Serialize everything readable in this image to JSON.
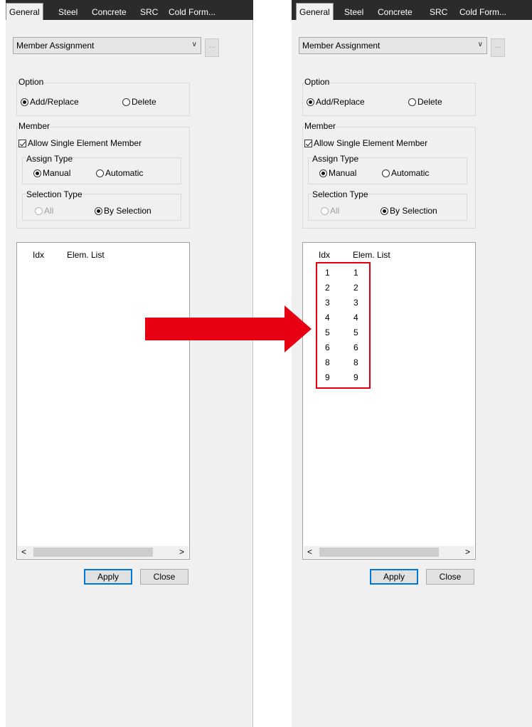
{
  "tabs": [
    "General",
    "Steel",
    "Concrete",
    "SRC",
    "Cold Form..."
  ],
  "combo": {
    "value": "Member Assignment"
  },
  "more_button": {
    "label": "..."
  },
  "option": {
    "title": "Option",
    "add_replace": "Add/Replace",
    "delete": "Delete",
    "selected": "Add/Replace"
  },
  "member": {
    "title": "Member",
    "allow_single": "Allow Single Element Member",
    "allow_single_checked": true,
    "assign_type": {
      "title": "Assign Type",
      "manual": "Manual",
      "automatic": "Automatic",
      "selected": "Manual"
    },
    "selection_type": {
      "title": "Selection Type",
      "all": "All",
      "by_selection": "By Selection",
      "selected": "By Selection",
      "all_disabled": true
    }
  },
  "list": {
    "columns": [
      "Idx",
      "Elem. List"
    ]
  },
  "rows_after": [
    [
      "1",
      "1"
    ],
    [
      "2",
      "2"
    ],
    [
      "3",
      "3"
    ],
    [
      "4",
      "4"
    ],
    [
      "5",
      "5"
    ],
    [
      "6",
      "6"
    ],
    [
      "8",
      "8"
    ],
    [
      "9",
      "9"
    ]
  ],
  "scroll": {
    "left": "<",
    "right": ">"
  },
  "buttons": {
    "apply": "Apply",
    "close": "Close"
  },
  "colors": {
    "arrow": "#e60012",
    "highlight": "#e60012",
    "tabbar": "#2b2b2b",
    "accent": "#0078d7"
  }
}
